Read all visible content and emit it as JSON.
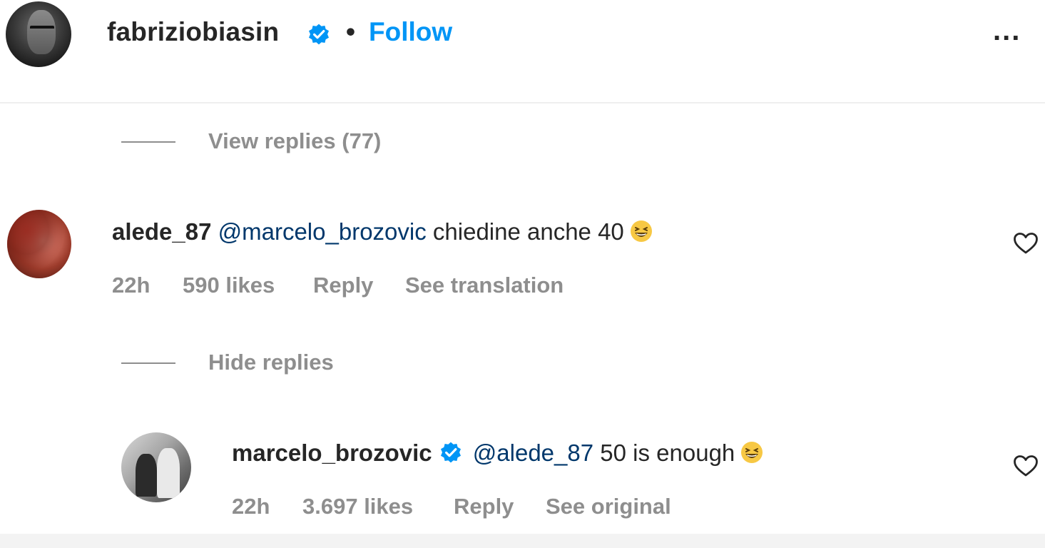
{
  "header": {
    "username": "fabriziobiasin",
    "separator": "•",
    "follow_label": "Follow",
    "more_label": "..."
  },
  "thread1": {
    "view_replies_label": "View replies (77)"
  },
  "comment1": {
    "username": "alede_87",
    "mention": "@marcelo_brozovic",
    "text": "chiedine anche 40",
    "emoji_icon": "grinning-squinting-face-icon",
    "time": "22h",
    "likes": "590 likes",
    "reply_label": "Reply",
    "translation_label": "See translation",
    "hide_replies_label": "Hide replies"
  },
  "reply1": {
    "username": "marcelo_brozovic",
    "mention": "@alede_87",
    "text": "50 is enough",
    "emoji_icon": "grinning-squinting-face-icon",
    "time": "22h",
    "likes": "3.697 likes",
    "reply_label": "Reply",
    "original_label": "See original"
  },
  "colors": {
    "link_blue": "#0095f6",
    "mention_blue": "#00376b",
    "muted_gray": "#8e8e8e",
    "text_dark": "#262626"
  }
}
